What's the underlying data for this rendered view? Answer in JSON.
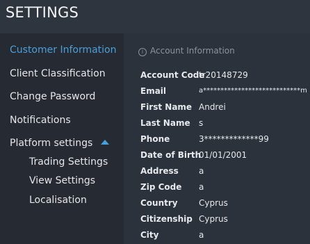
{
  "header": {
    "title": "SETTINGS"
  },
  "sidebar": {
    "items": [
      {
        "label": "Customer Information"
      },
      {
        "label": "Client Classification"
      },
      {
        "label": "Change Password"
      },
      {
        "label": "Notifications"
      },
      {
        "label": "Platform settings"
      }
    ],
    "sub_items": [
      {
        "label": "Trading Settings"
      },
      {
        "label": "View Settings"
      },
      {
        "label": "Localisation"
      }
    ]
  },
  "main": {
    "section_title": "Account Information",
    "fields": [
      {
        "label": "Account Code",
        "value": "tr20148729"
      },
      {
        "label": "Email",
        "value": "a****************************m"
      },
      {
        "label": "First Name",
        "value": "Andrei"
      },
      {
        "label": "Last Name",
        "value": "s"
      },
      {
        "label": "Phone",
        "value": "3*************99"
      },
      {
        "label": "Date of Birth",
        "value": "01/01/2001"
      },
      {
        "label": "Address",
        "value": "a"
      },
      {
        "label": "Zip Code",
        "value": "a"
      },
      {
        "label": "Country",
        "value": "Cyprus"
      },
      {
        "label": "Citizenship",
        "value": "Cyprus"
      },
      {
        "label": "City",
        "value": "a"
      }
    ]
  },
  "colors": {
    "accent": "#4a9fd8",
    "sidebar_bg": "#262b33",
    "main_bg": "#2c323b"
  }
}
